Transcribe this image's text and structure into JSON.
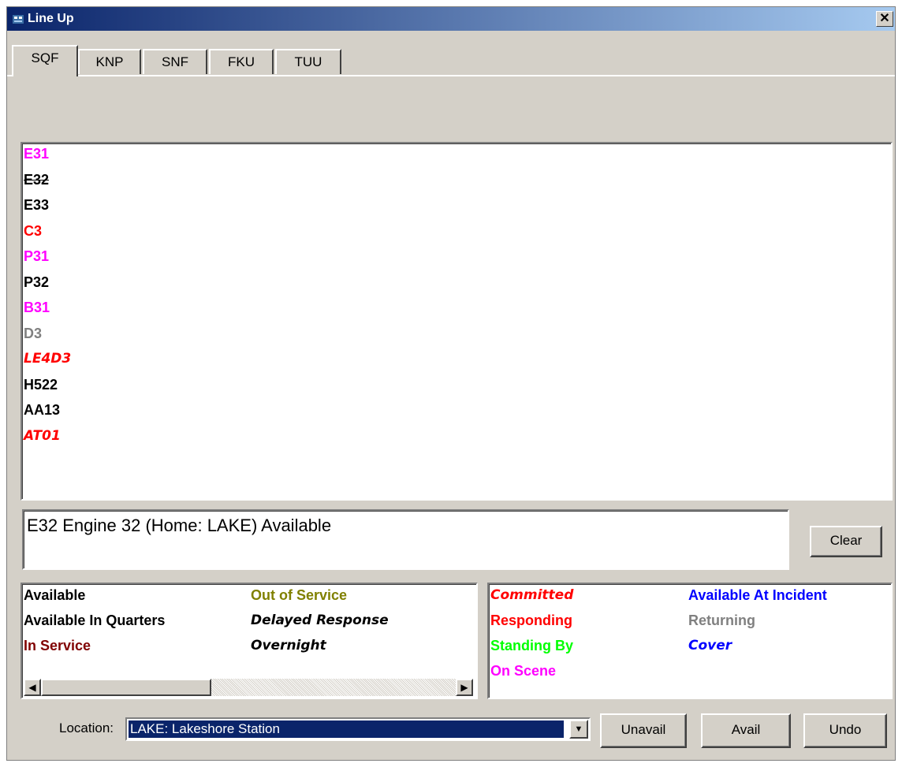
{
  "window": {
    "title": "Line Up",
    "close_label": "✕"
  },
  "tabs": [
    {
      "label": "SQF",
      "active": true
    },
    {
      "label": "KNP"
    },
    {
      "label": "SNF"
    },
    {
      "label": "FKU"
    },
    {
      "label": "TUU"
    }
  ],
  "units": [
    {
      "label": "E31",
      "color": "#ff00ff"
    },
    {
      "label": "E32",
      "color": "#000000",
      "style": "strike"
    },
    {
      "label": "E33",
      "color": "#000000"
    },
    {
      "label": "C3",
      "color": "#ff0000"
    },
    {
      "label": "P31",
      "color": "#ff00ff"
    },
    {
      "label": "P32",
      "color": "#000000"
    },
    {
      "label": "B31",
      "color": "#ff00ff"
    },
    {
      "label": "D3",
      "color": "#808080"
    },
    {
      "label": "LE4D3",
      "color": "#ff0000",
      "style": "italic"
    },
    {
      "label": "H522",
      "color": "#000000"
    },
    {
      "label": "AA13",
      "color": "#000000"
    },
    {
      "label": "AT01",
      "color": "#ff0000",
      "style": "italic"
    }
  ],
  "info": {
    "text": "E32 Engine 32 (Home: LAKE) Available"
  },
  "buttons": {
    "clear": "Clear",
    "unavail": "Unavail",
    "avail": "Avail",
    "undo": "Undo"
  },
  "legend_left": [
    {
      "label": "Available",
      "color": "#000000"
    },
    {
      "label": "Available In Quarters",
      "color": "#000000"
    },
    {
      "label": "In Service",
      "color": "#800000"
    },
    {
      "label": "Out of Service",
      "color": "#808000"
    },
    {
      "label": "Delayed Response",
      "color": "#000000",
      "style": "italic"
    },
    {
      "label": "Overnight",
      "color": "#000000",
      "style": "italic"
    }
  ],
  "legend_right": [
    {
      "label": "Committed",
      "color": "#ff0000",
      "style": "italic"
    },
    {
      "label": "Responding",
      "color": "#ff0000"
    },
    {
      "label": "Standing By",
      "color": "#00ff00"
    },
    {
      "label": "On Scene",
      "color": "#ff00ff"
    },
    {
      "label": "Available At Incident",
      "color": "#0000ff"
    },
    {
      "label": "Returning",
      "color": "#808080"
    },
    {
      "label": "Cover",
      "color": "#0000ff",
      "style": "italic"
    }
  ],
  "location": {
    "label": "Location:",
    "value": "LAKE: Lakeshore Station"
  },
  "scroll": {
    "left_arrow": "◀",
    "right_arrow": "▶",
    "dropdown_arrow": "▼"
  }
}
